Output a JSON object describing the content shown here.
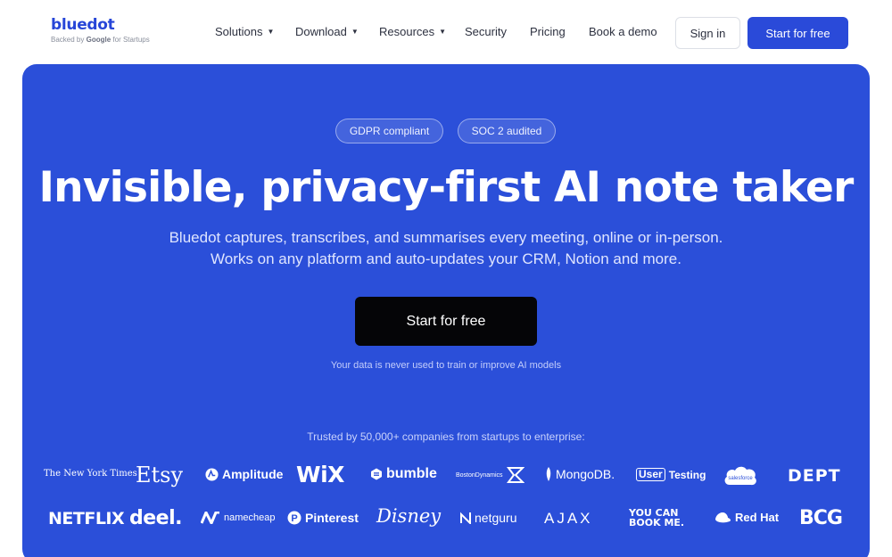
{
  "brand": {
    "name": "bluedot",
    "tagline_prefix": "Backed by",
    "tagline_google": "Google",
    "tagline_suffix": "for Startups"
  },
  "nav": {
    "solutions": "Solutions",
    "download": "Download",
    "resources": "Resources",
    "security": "Security",
    "pricing": "Pricing",
    "book_demo": "Book a demo",
    "sign_in": "Sign in",
    "start_free": "Start for free"
  },
  "hero": {
    "badge_gdpr": "GDPR compliant",
    "badge_soc2": "SOC 2 audited",
    "headline": "Invisible, privacy-first AI note taker",
    "sub_line1": "Bluedot captures, transcribes, and summarises every meeting, online or in-person.",
    "sub_line2": "Works on any platform and auto-updates your CRM, Notion and more.",
    "cta": "Start for free",
    "note": "Your data is never used to train or improve AI models",
    "trusted": "Trusted by 50,000+ companies from startups to enterprise:"
  },
  "logos": {
    "nyt": "The New York Times",
    "etsy": "Etsy",
    "amplitude": "Amplitude",
    "wix": "WiX",
    "bumble": "bumble",
    "boston": "BostonDynamics",
    "mongodb": "MongoDB.",
    "usertesting_a": "User",
    "usertesting_b": "Testing",
    "salesforce": "salesforce",
    "dept": "DEPT",
    "netflix": "NETFLIX",
    "deel": "deel.",
    "namecheap": "namecheap",
    "pinterest": "Pinterest",
    "disney": "Disney",
    "netguru": "netguru",
    "ajax": "AJAX",
    "ycbm_1": "YOU CAN",
    "ycbm_2": "BOOK ME.",
    "redhat": "Red Hat",
    "bcg": "BCG"
  },
  "colors": {
    "accent": "#2a4ad9",
    "hero_bg": "#2b4fd9",
    "cta_bg": "#050507"
  }
}
